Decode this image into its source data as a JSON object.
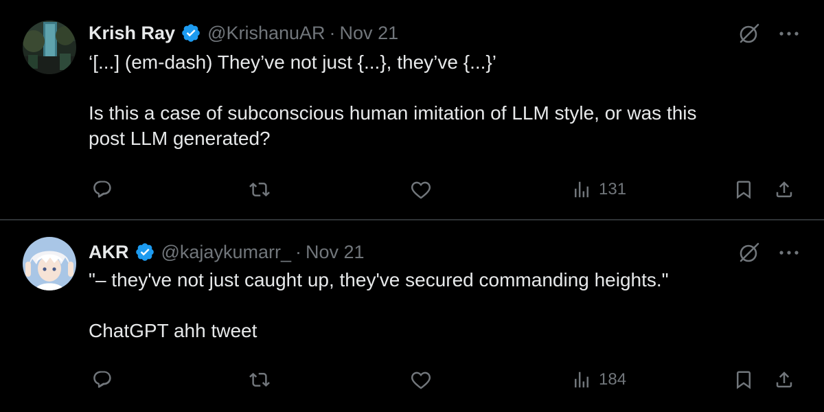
{
  "tweets": [
    {
      "display_name": "Krish Ray",
      "handle": "@KrishanuAR",
      "separator": "·",
      "date": "Nov 21",
      "lines": [
        "‘[...] (em-dash) They’ve not just {...}, they’ve {...}’",
        "",
        "Is this a case of subconscious human imitation of LLM style, or was this",
        "post LLM generated?"
      ],
      "views": "131",
      "verified": true
    },
    {
      "display_name": "AKR",
      "handle": "@kajaykumarr_",
      "separator": "·",
      "date": "Nov 21",
      "lines": [
        "\"– they've not just caught up, they've secured commanding heights.\"",
        "",
        "ChatGPT ahh tweet"
      ],
      "views": "184",
      "verified": true
    }
  ],
  "icons": {
    "verified": "verified-badge-icon",
    "grok": "grok-icon",
    "more": "more-icon",
    "reply": "reply-icon",
    "retweet": "retweet-icon",
    "like": "like-icon",
    "views": "views-icon",
    "bookmark": "bookmark-icon",
    "share": "share-icon"
  },
  "colors": {
    "background": "#000000",
    "text": "#e7e9ea",
    "secondary": "#71767b",
    "verified": "#1d9bf0",
    "divider": "#2f3336"
  }
}
